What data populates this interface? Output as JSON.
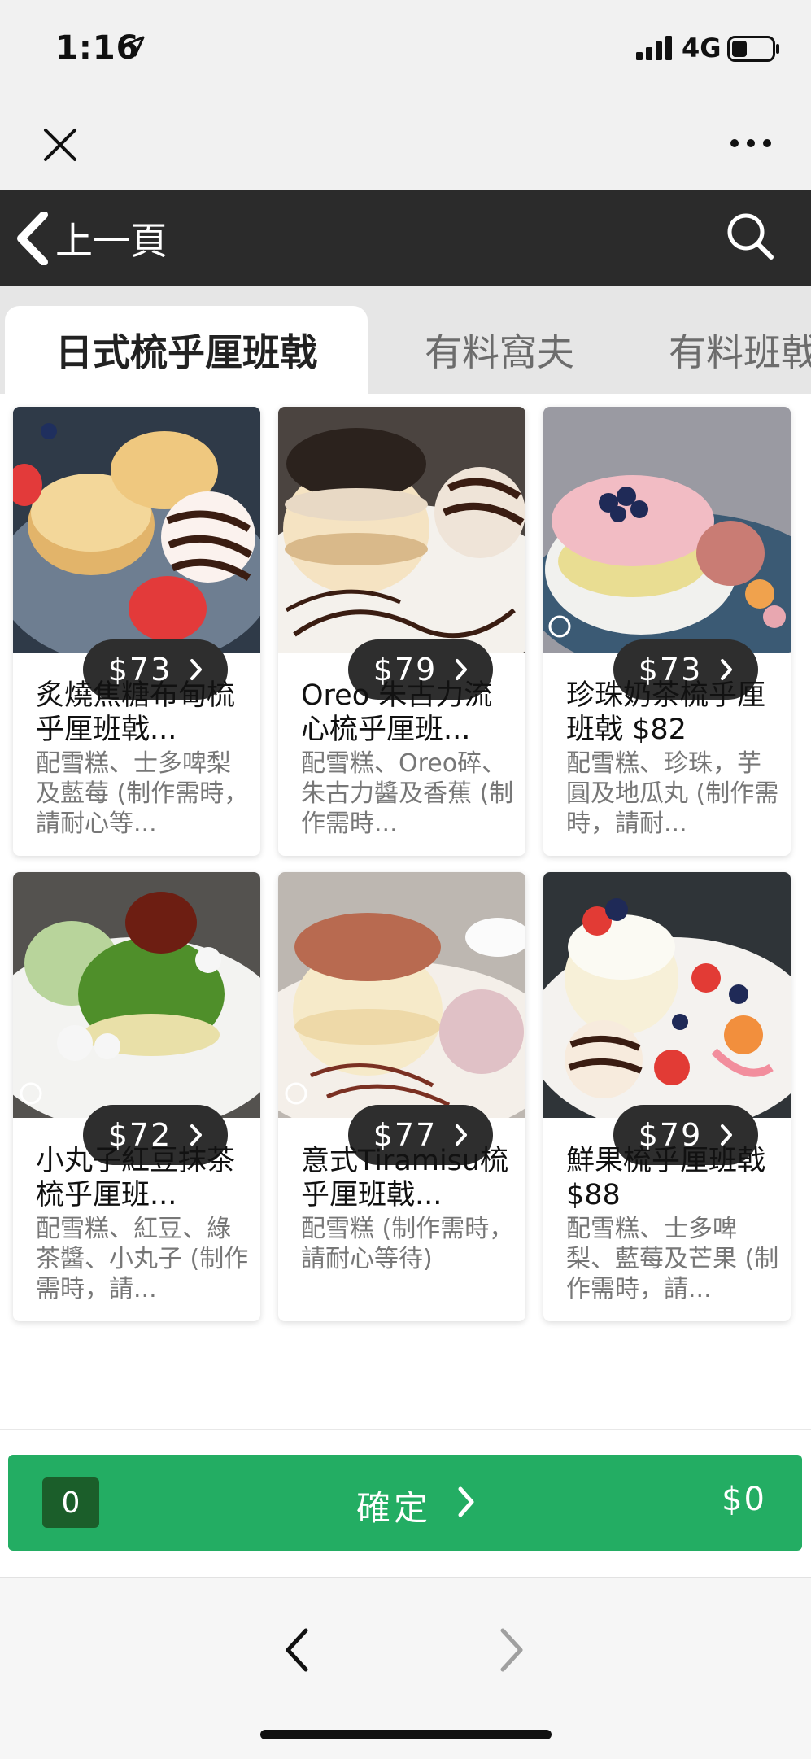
{
  "status_bar": {
    "time": "1:16",
    "network": "4G",
    "icons": [
      "location-arrow-icon",
      "signal-bars-icon",
      "battery-icon"
    ]
  },
  "webview_bar": {
    "close_icon": "close-icon",
    "more_icon": "more-dots-icon"
  },
  "header": {
    "back_label": "上一頁",
    "search_icon": "search-icon"
  },
  "tabs": [
    {
      "label": "日式梳乎厘班戟",
      "active": true
    },
    {
      "label": "有料窩夫",
      "active": false
    },
    {
      "label": "有料班戟",
      "active": false
    }
  ],
  "products": [
    {
      "price": "$73",
      "title": "炙燒焦糖布甸梳乎厘班戟...",
      "description": "配雪糕、士多啤梨及藍莓 (制作需時，請耐心等...",
      "image": "pancake-brulee-photo"
    },
    {
      "price": "$79",
      "title": "Oreo 朱古力流心梳乎厘班...",
      "description": "配雪糕、Oreo碎、朱古力醬及香蕉 (制作需時...",
      "image": "pancake-oreo-photo"
    },
    {
      "price": "$73",
      "title": "珍珠奶茶梳乎厘班戟 $82",
      "description": "配雪糕、珍珠，芋圓及地瓜丸 (制作需時，請耐...",
      "image": "pancake-bubble-tea-photo"
    },
    {
      "price": "$72",
      "title": "小丸子紅豆抹茶梳乎厘班...",
      "description": "配雪糕、紅豆、綠茶醬、小丸子 (制作需時，請...",
      "image": "pancake-matcha-photo"
    },
    {
      "price": "$77",
      "title": "意式Tiramisu梳乎厘班戟...",
      "description": "配雪糕 (制作需時，請耐心等待)",
      "image": "pancake-tiramisu-photo"
    },
    {
      "price": "$79",
      "title": "鮮果梳乎厘班戟 $88",
      "description": "配雪糕、士多啤梨、藍莓及芒果 (制作需時，請...",
      "image": "pancake-fresh-fruit-photo"
    }
  ],
  "confirm_bar": {
    "count": "0",
    "label": "確定",
    "total": "$0",
    "color": "#23ad63"
  },
  "browser_nav": {
    "back_icon": "nav-back-icon",
    "forward_icon": "nav-forward-icon"
  },
  "colors": {
    "header_bg": "#2b2b2b",
    "tab_bar_bg": "#e6e6e6",
    "price_pill_bg": "#2e2e2e",
    "confirm_green": "#23ad63",
    "badge_green": "#1b5e2a"
  }
}
